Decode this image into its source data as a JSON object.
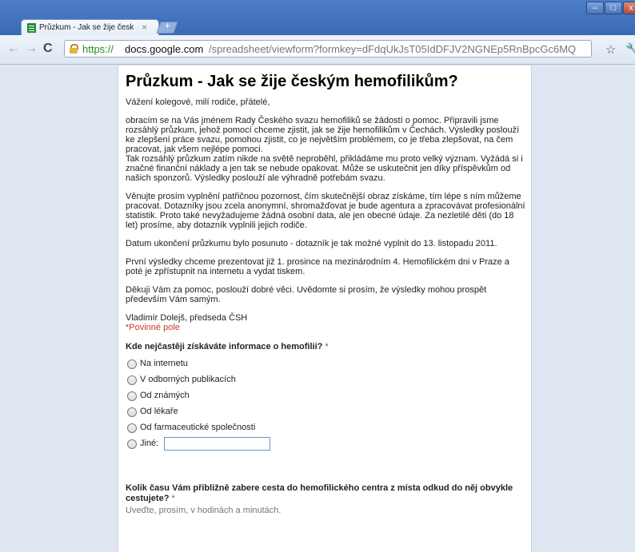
{
  "browser": {
    "tab_title": "Průzkum - Jak se žije českým h",
    "tab_close": "×",
    "new_tab": "+",
    "window_controls": {
      "minimize": "–",
      "maximize": "□",
      "close": "x"
    },
    "nav": {
      "back": "←",
      "forward": "→",
      "reload": "C"
    },
    "url": {
      "scheme": "https://",
      "host": "docs.google.com",
      "path": "/spreadsheet/viewform?formkey=dFdqUkJsT05IdDFJV2NGNEp5RnBpcGc6MQ"
    },
    "bookmark_star": "☆",
    "menu_icon": "wrench-icon"
  },
  "form": {
    "title": "Průzkum - Jak se žije českým hemofilikům?",
    "paragraphs": [
      "Vážení kolegové, milí rodiče, přátelé,",
      "obracím se na Vás jménem Rady Českého svazu hemofiliků se žádostí o pomoc. Připravili jsme rozsáhlý průzkum, jehož pomocí chceme zjistit, jak se žije hemofilikům v Čechách. Výsledky poslouží ke zlepšení práce svazu, pomohou zjistit, co je největším problémem, co je třeba zlepšovat, na čem pracovat, jak všem nejlépe pomoci.\nTak rozsáhlý průzkum zatím nikde na světě neproběhl, přikládáme mu proto velký význam. Vyžádá si i značné finanční náklady a jen tak se nebude opakovat. Může se uskutečnit jen díky příspěvkům od našich sponzorů. Výsledky poslouží ale výhradně potřebám svazu.",
      "Věnujte prosím vyplnění patřičnou pozornost, čím skutečnější obraz získáme, tím lépe s ním můžeme pracovat. Dotazníky jsou zcela anonymní, shromažďovat je bude agentura a zpracovávat profesionální statistik. Proto také nevyžadujeme žádná osobní data, ale jen obecné údaje. Za nezletilé děti (do 18 let) prosíme, aby dotazník vyplnili jejich rodiče.",
      "Datum ukončení průzkumu bylo posunuto - dotazník je tak možné vyplnit do 13. listopadu 2011.",
      "První výsledky chceme prezentovat již 1. prosince na mezinárodním 4. Hemofilickém dni v Praze a poté je zpřístupnit na internetu a vydat tiskem.",
      "Děkuji Vám za pomoc, poslouží dobré věci. Uvědomte si prosím, že výsledky mohou prospět především Vám samým.",
      "Vladimír Dolejš, předseda ČSH"
    ],
    "required_note": "*Povinné pole",
    "question1": {
      "label": "Kde nejčastěji získáváte informace o hemofilii?",
      "required_marker": "*",
      "options": [
        "Na internetu",
        "V odborných publikacích",
        "Od známých",
        "Od lékaře",
        "Od farmaceutické společnosti"
      ],
      "other_label": "Jiné:"
    },
    "question2": {
      "label": "Kolik času Vám přibližně zabere cesta do hemofilického centra z místa odkud do něj obvykle cestujete?",
      "required_marker": "*",
      "help": "Uveďte, prosím, v hodinách a minutách."
    }
  }
}
